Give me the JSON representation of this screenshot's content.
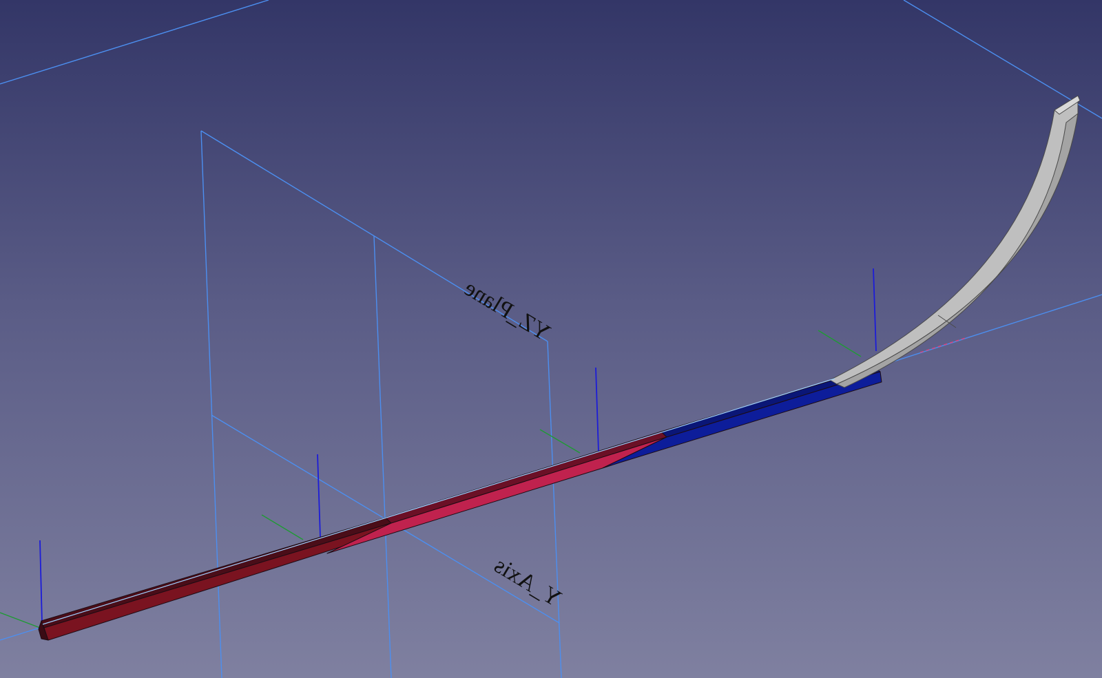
{
  "viewport": {
    "background_top": "#333667",
    "background_bottom": "#7f80a0",
    "helper_color": "#4c8ff0"
  },
  "labels": {
    "yz_plane": "YZ_Plane",
    "y_axis": "Y_Axis"
  },
  "colors": {
    "segment_dark_red": "#7a1320",
    "segment_pink": "#c0224e",
    "segment_blue": "#0d1d9a",
    "curved_part": "#a9a9a9",
    "placement_z": "#1c1cd8",
    "placement_y": "#1f9a34"
  },
  "icons": {
    "origin_marker": "crosshair-icon"
  }
}
